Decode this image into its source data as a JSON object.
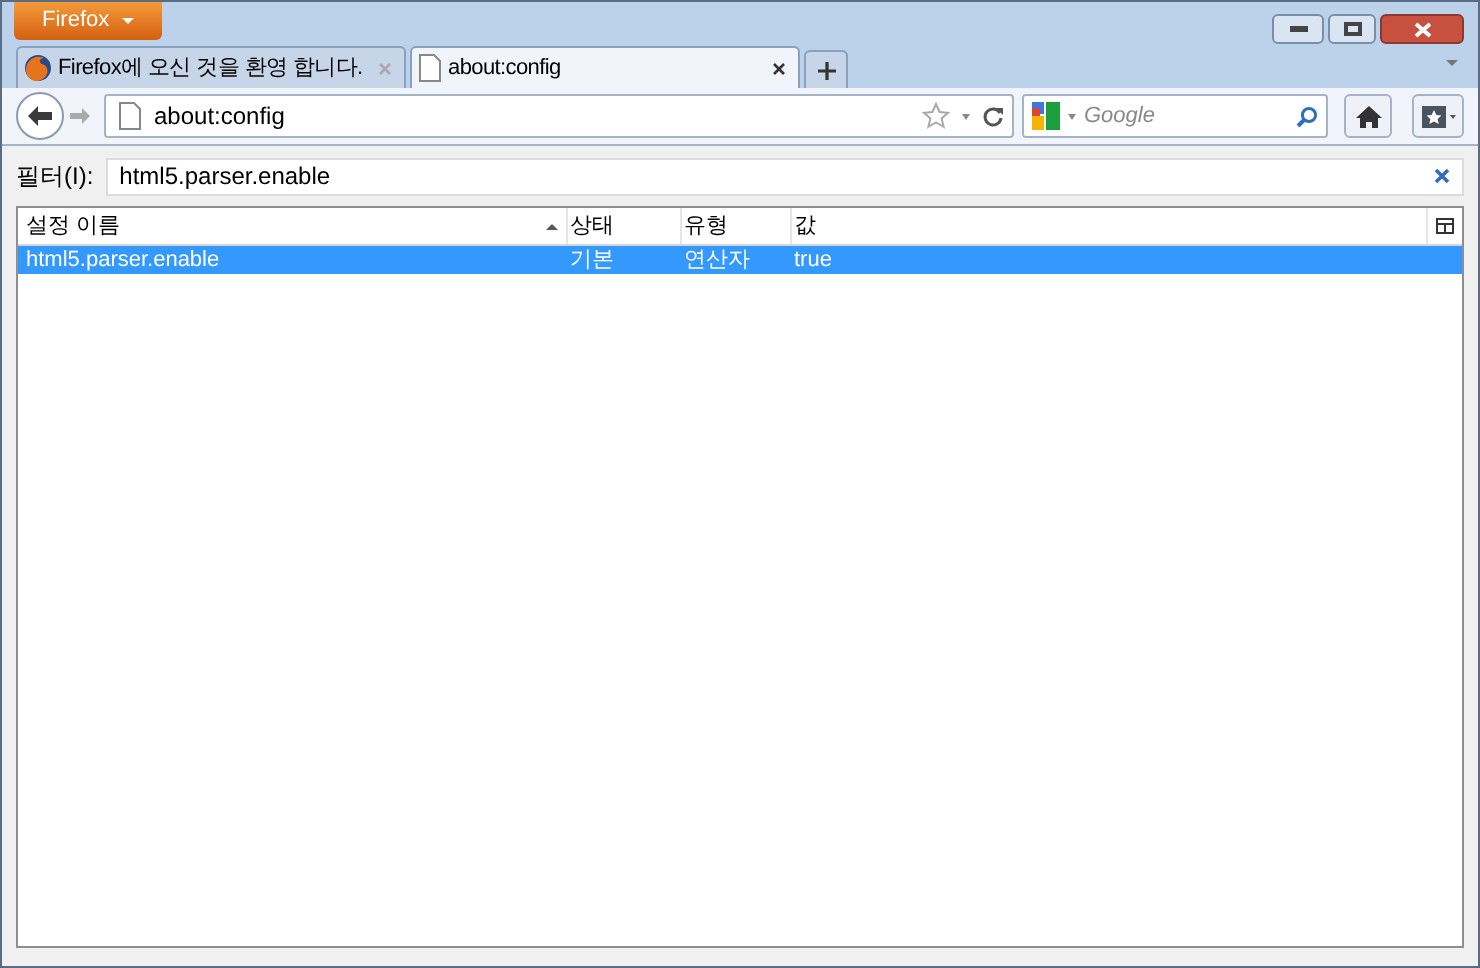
{
  "app_button": {
    "label": "Firefox"
  },
  "tabs": [
    {
      "title": "Firefox에 오신 것을 환영 합니다.",
      "kind": "firefox",
      "selected": false
    },
    {
      "title": "about:config",
      "kind": "page",
      "selected": true
    }
  ],
  "nav": {
    "url": "about:config",
    "search_placeholder": "Google"
  },
  "filter": {
    "label": "필터(I):",
    "value": "html5.parser.enable"
  },
  "table": {
    "columns": [
      {
        "label": "설정 이름",
        "sorted": true
      },
      {
        "label": "상태",
        "sorted": false
      },
      {
        "label": "유형",
        "sorted": false
      },
      {
        "label": "값",
        "sorted": false
      }
    ],
    "rows": [
      {
        "cells": [
          "html5.parser.enable",
          "기본",
          "연산자",
          "true"
        ],
        "selected": true
      }
    ]
  }
}
